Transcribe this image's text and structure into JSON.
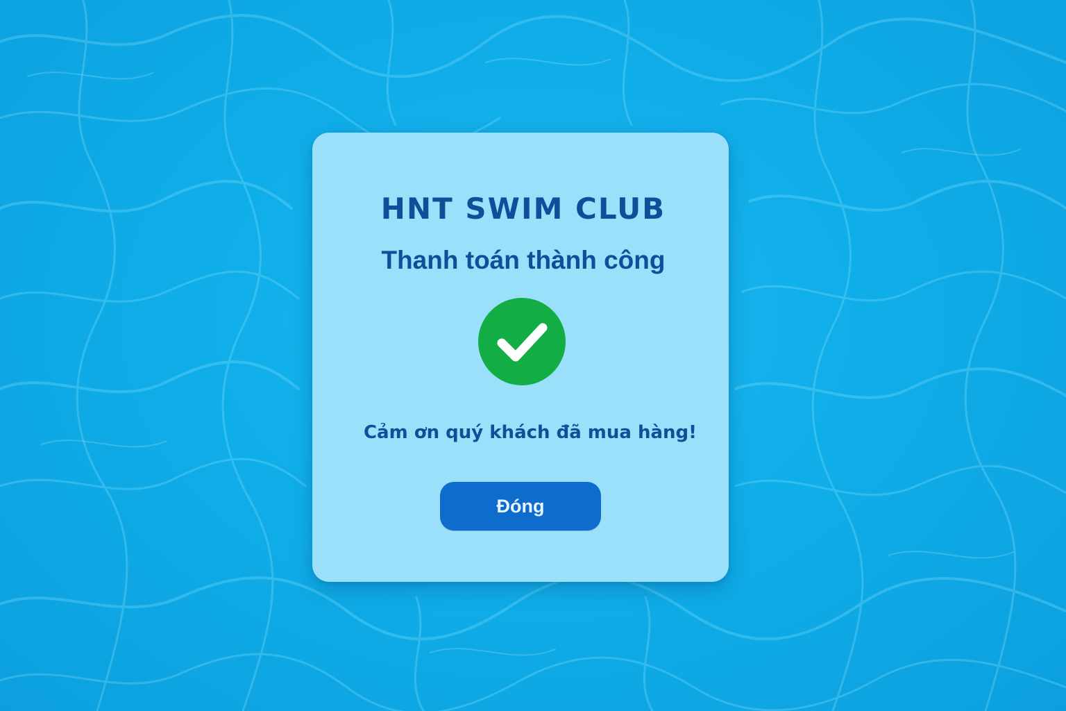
{
  "background": {
    "description_icon": "pool-water-background",
    "colors": {
      "water": "#10aee9",
      "water_dark": "#0c9fde",
      "caustic_highlight": "#7fe3ff"
    }
  },
  "dialog": {
    "club_name": "HNT SWIM CLUB",
    "status_title": "Thanh toán thành công",
    "status_icon": "check-circle-icon",
    "thanks_message": "Cảm ơn quý khách đã mua hàng!",
    "close_label": "Đóng",
    "colors": {
      "panel": "#9be0fa",
      "heading_text": "#0d4f98",
      "success_green": "#12ad44",
      "button": "#0e6ccc",
      "button_text": "#e8f4ff"
    }
  }
}
